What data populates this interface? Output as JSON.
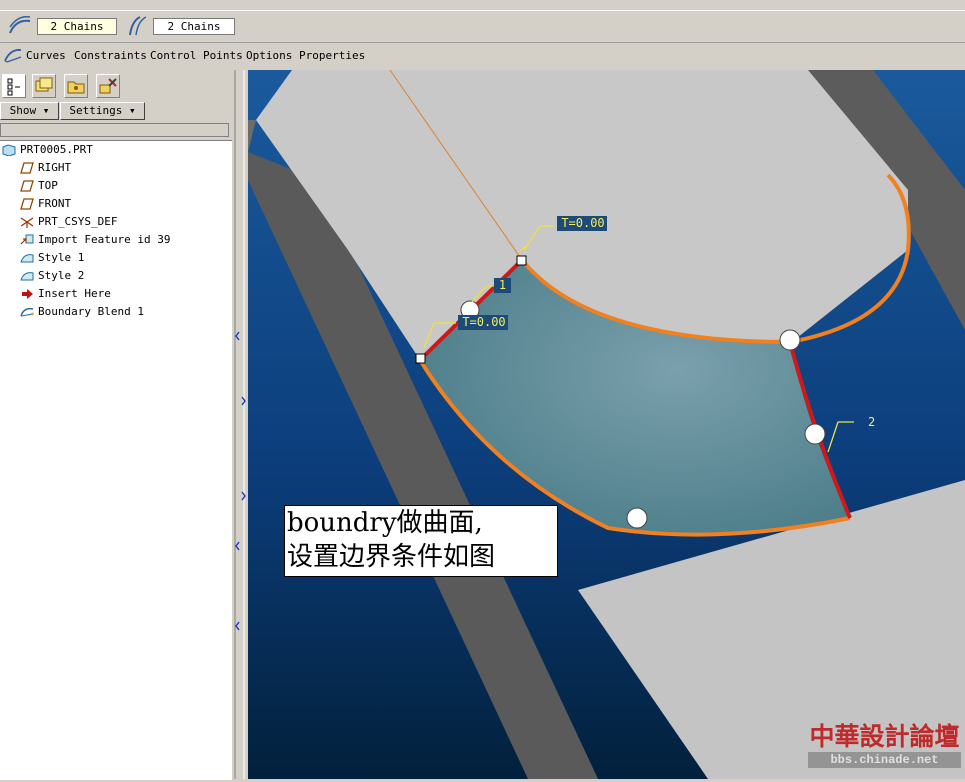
{
  "chain_bar": {
    "first_chains": "2 Chains",
    "second_chains": "2 Chains"
  },
  "tabs": [
    "Curves",
    "Constraints",
    "Control Points",
    "Options",
    "Properties"
  ],
  "left_panel": {
    "show_label": "Show",
    "settings_label": "Settings"
  },
  "tree": {
    "root": "PRT0005.PRT",
    "items": [
      "RIGHT",
      "TOP",
      "FRONT",
      "PRT_CSYS_DEF",
      "Import Feature id 39",
      "Style 1",
      "Style 2",
      "Insert Here",
      "Boundary Blend 1"
    ]
  },
  "viewport": {
    "tangency_label_top": "T=0.00",
    "tangency_label_left": "T=0.00",
    "chain_number_1": "1",
    "chain_number_2": "2"
  },
  "annotation": {
    "line1": "boundry做曲面,",
    "line2": "设置边界条件如图"
  },
  "watermark": {
    "title": "中華設計論壇",
    "url": "bbs.chinade.net"
  },
  "colors": {
    "background_blue": "#0a3a78",
    "surface_gray": "#c8c8c8",
    "edge_orange": "#f08020",
    "edge_red": "#d01818",
    "blend_surface": "#5c8898"
  },
  "icons": [
    "curve-chain-icon",
    "curve-chain-icon",
    "model-tree-icon",
    "layer-icon",
    "folder-icon",
    "tools-icon",
    "part-icon",
    "datum-plane-icon",
    "csys-icon",
    "import-icon",
    "style-surface-icon",
    "insert-arrow-icon",
    "boundary-blend-icon"
  ]
}
